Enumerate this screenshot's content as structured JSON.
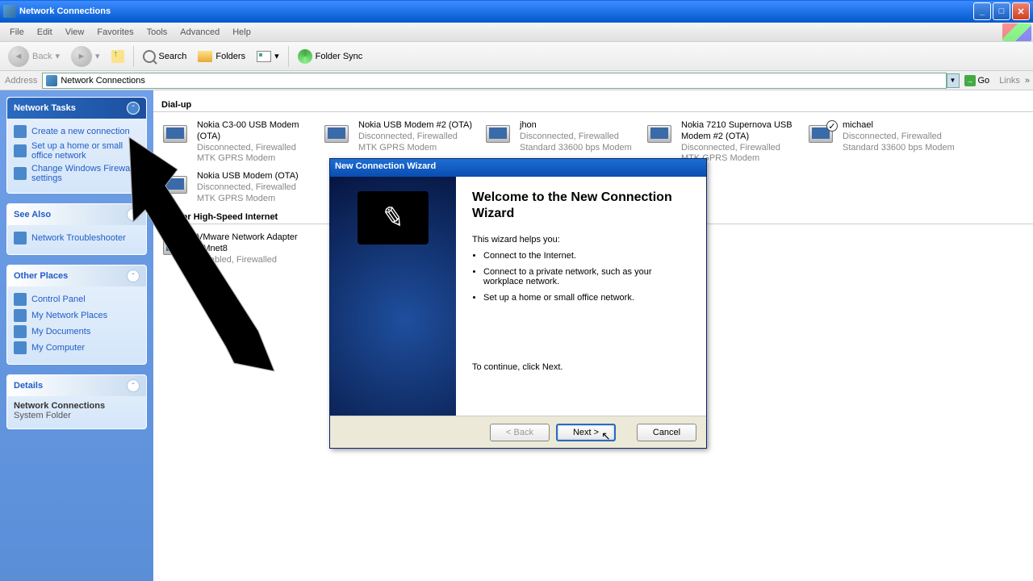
{
  "window": {
    "title": "Network Connections"
  },
  "menu": {
    "items": [
      "File",
      "Edit",
      "View",
      "Favorites",
      "Tools",
      "Advanced",
      "Help"
    ]
  },
  "toolbar": {
    "back": "Back",
    "search": "Search",
    "folders": "Folders",
    "folder_sync": "Folder Sync"
  },
  "address": {
    "label": "Address",
    "value": "Network Connections",
    "go": "Go",
    "links": "Links"
  },
  "sidebar": {
    "tasks": {
      "title": "Network Tasks",
      "items": [
        "Create a new connection",
        "Set up a home or small office network",
        "Change Windows Firewall settings"
      ]
    },
    "seealso": {
      "title": "See Also",
      "items": [
        "Network Troubleshooter"
      ]
    },
    "other": {
      "title": "Other Places",
      "items": [
        "Control Panel",
        "My Network Places",
        "My Documents",
        "My Computer"
      ]
    },
    "details": {
      "title": "Details",
      "name": "Network Connections",
      "type": "System Folder"
    }
  },
  "groups": {
    "dialup": {
      "label": "Dial-up",
      "items": [
        {
          "name": "Nokia C3-00 USB Modem (OTA)",
          "status": "Disconnected, Firewalled",
          "device": "MTK GPRS Modem"
        },
        {
          "name": "Nokia USB Modem #2 (OTA)",
          "status": "Disconnected, Firewalled",
          "device": "MTK GPRS Modem"
        },
        {
          "name": "jhon",
          "status": "Disconnected, Firewalled",
          "device": "Standard 33600 bps Modem"
        },
        {
          "name": "Nokia 7210 Supernova USB Modem #2 (OTA)",
          "status": "Disconnected, Firewalled",
          "device": "MTK GPRS Modem"
        },
        {
          "name": "michael",
          "status": "Disconnected, Firewalled",
          "device": "Standard 33600 bps Modem",
          "default": true
        },
        {
          "name": "Nokia USB Modem (OTA)",
          "status": "Disconnected, Firewalled",
          "device": "MTK GPRS Modem"
        }
      ]
    },
    "lan": {
      "label": "LAN or High-Speed Internet",
      "items": [
        {
          "name": "VMware Network Adapter VMnet8",
          "status": "Disabled, Firewalled",
          "device": ""
        }
      ]
    }
  },
  "wizard": {
    "titlebar": "New Connection Wizard",
    "heading": "Welcome to the New Connection Wizard",
    "intro": "This wizard helps you:",
    "bullets": [
      "Connect to the Internet.",
      "Connect to a private network, such as your workplace network.",
      "Set up a home or small office network."
    ],
    "continue": "To continue, click Next.",
    "back": "< Back",
    "next": "Next >",
    "cancel": "Cancel"
  }
}
